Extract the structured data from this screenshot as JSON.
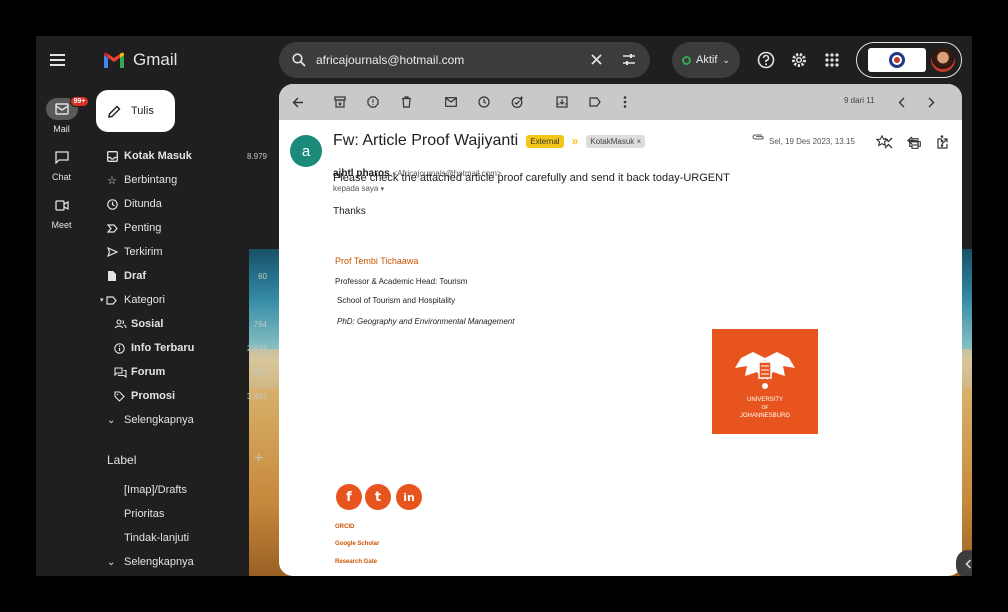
{
  "app": {
    "name": "Gmail"
  },
  "rail": {
    "mail_label": "Mail",
    "mail_badge": "99+",
    "chat_label": "Chat",
    "meet_label": "Meet"
  },
  "search": {
    "value": "africajournals@hotmail.com"
  },
  "status": {
    "label": "Aktif",
    "color": "#34a853"
  },
  "compose": {
    "label": "Tulis"
  },
  "nav": {
    "items": [
      {
        "label": "Kotak Masuk",
        "count": "8.979",
        "icon": "inbox-icon"
      },
      {
        "label": "Berbintang",
        "count": "",
        "icon": "star-icon"
      },
      {
        "label": "Ditunda",
        "count": "",
        "icon": "clock-icon"
      },
      {
        "label": "Penting",
        "count": "",
        "icon": "important-icon"
      },
      {
        "label": "Terkirim",
        "count": "",
        "icon": "send-icon"
      },
      {
        "label": "Draf",
        "count": "60",
        "icon": "draft-icon"
      },
      {
        "label": "Kategori",
        "count": "",
        "icon": "label-icon"
      },
      {
        "label": "Sosial",
        "count": "764",
        "icon": "people-icon"
      },
      {
        "label": "Info Terbaru",
        "count": "2.633",
        "icon": "info-icon"
      },
      {
        "label": "Forum",
        "count": "101",
        "icon": "forum-icon"
      },
      {
        "label": "Promosi",
        "count": "3.483",
        "icon": "tag-icon"
      },
      {
        "label": "Selengkapnya",
        "count": "",
        "icon": "chevron-down-icon"
      }
    ]
  },
  "labels": {
    "heading": "Label",
    "add": "+",
    "items": [
      {
        "label": "[Imap]/Drafts"
      },
      {
        "label": "Prioritas"
      },
      {
        "label": "Tindak-lanjuti"
      },
      {
        "label": "Selengkapnya"
      }
    ]
  },
  "email": {
    "pager": "9 dari 11",
    "subject": "Fw: Article Proof Wajiyanti",
    "external_tag": "External",
    "label_chip": "KotakMasuk ×",
    "sender_initial": "a",
    "sender_name": "ajhtl pharos",
    "sender_email": "<Africajournals@hotmail.com>",
    "to": "kepada saya",
    "date": "Sel, 19 Des 2023, 13.15",
    "body": "Please check the attached article proof carefully and send it back today-URGENT",
    "thanks": "Thanks",
    "signature": {
      "name": "Prof Tembi Tichaawa",
      "lines": [
        "Professor & Academic Head: Tourism",
        "School of Tourism and Hospitality",
        "PhD: Geography and Environmental Management"
      ],
      "logo_lines": [
        "UNIVERSITY",
        "OF",
        "JOHANNESBURG"
      ],
      "logo_color": "#e8541d",
      "social": [
        {
          "glyph": "f",
          "icon": "facebook-icon"
        },
        {
          "glyph": "t",
          "icon": "twitter-icon"
        },
        {
          "glyph": "in",
          "icon": "linkedin-icon"
        }
      ],
      "links": [
        "ORCID",
        "Google Scholar",
        "Research Gate"
      ]
    }
  }
}
